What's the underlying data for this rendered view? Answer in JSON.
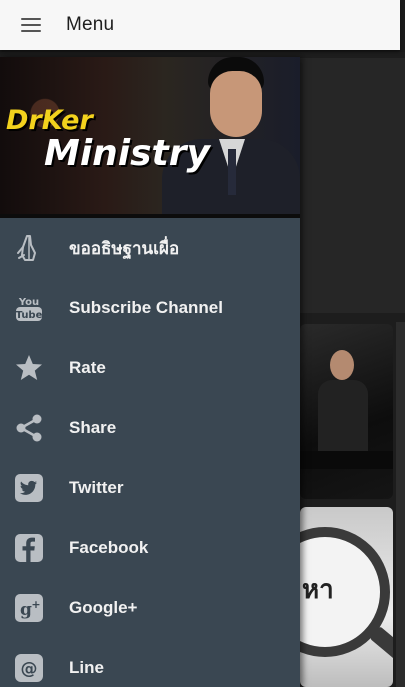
{
  "appbar": {
    "title": "Menu",
    "menu_icon": "hamburger-icon"
  },
  "drawer": {
    "header": {
      "logo_line1": "DrKer",
      "logo_line2": "Ministry"
    },
    "items": [
      {
        "label": "ขออธิษฐานเผื่อ",
        "icon": "praying-hands-icon"
      },
      {
        "label": "Subscribe Channel",
        "icon": "youtube-icon"
      },
      {
        "label": "Rate",
        "icon": "star-icon"
      },
      {
        "label": "Share",
        "icon": "share-icon"
      },
      {
        "label": "Twitter",
        "icon": "twitter-icon"
      },
      {
        "label": "Facebook",
        "icon": "facebook-icon"
      },
      {
        "label": "Google+",
        "icon": "google-plus-icon"
      },
      {
        "label": "Line",
        "icon": "line-icon"
      }
    ]
  },
  "background": {
    "card_glyph": "หา"
  },
  "colors": {
    "drawer_bg": "#3a4752",
    "icon_gray": "#b9bec3",
    "label_text": "#f1f1f1",
    "appbar_bg": "#f7f7f7",
    "logo_yellow": "#f3d21d"
  }
}
